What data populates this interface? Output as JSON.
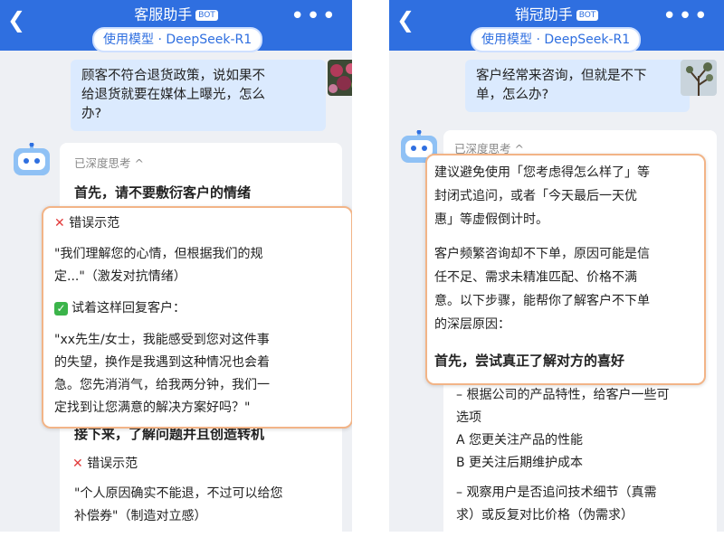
{
  "left": {
    "title": "客服助手",
    "bot_badge": "BOT",
    "model_pill": "使用模型 · DeepSeek-R1",
    "user_message": [
      "顾客不符合退货政策，说如果不",
      "给退货就要在媒体上曝光，怎么",
      "办?"
    ],
    "thinking_label": "已深度思考 ^",
    "heading_first": "首先，请不要敷衍客户的情绪",
    "wrong_label": "错误示范",
    "wrong_text": [
      "\"我们理解您的心情，但根据我们的规",
      "定...\"（激发对抗情绪）"
    ],
    "try_label": "试着这样回复客户：",
    "try_text": [
      "\"xx先生/女士，我能感受到您对这件事",
      "的失望，换作是我遇到这种情况也会着",
      "急。您先消消气，给我两分钟，我们一",
      "定找到让您满意的解决方案好吗？\""
    ],
    "heading_next": "接下来，了解问题并且创造转机",
    "wrong_label_2": "错误示范",
    "wrong_text_2": [
      "\"个人原因确实不能退，不过可以给您",
      "补偿券\"（制造对立感）"
    ]
  },
  "right": {
    "title": "销冠助手",
    "bot_badge": "BOT",
    "model_pill": "使用模型 · DeepSeek-R1",
    "user_message": [
      "客户经常来咨询，但就是不下",
      "单，怎么办?"
    ],
    "thinking_label": "已深度思考 ^",
    "para1": [
      "建议避免使用「您考虑得怎么样了」等",
      "封闭式追问，或者「今天最后一天优",
      "惠」等虚假倒计时。"
    ],
    "para2": [
      "客户频繁咨询却不下单，原因可能是信",
      "任不足、需求未精准匹配、价格不满",
      "意。以下步骤，能帮你了解客户不下单",
      "的深层原因："
    ],
    "heading_first": "首先，尝试真正了解对方的喜好",
    "under_lines": [
      "– 根据公司的产品特性，给客户一些可",
      "选项",
      "A 您更关注产品的性能",
      "B 更关注后期维护成本",
      "– 观察用户是否追问技术细节（真需",
      "求）或反复对比价格（伪需求）"
    ]
  }
}
